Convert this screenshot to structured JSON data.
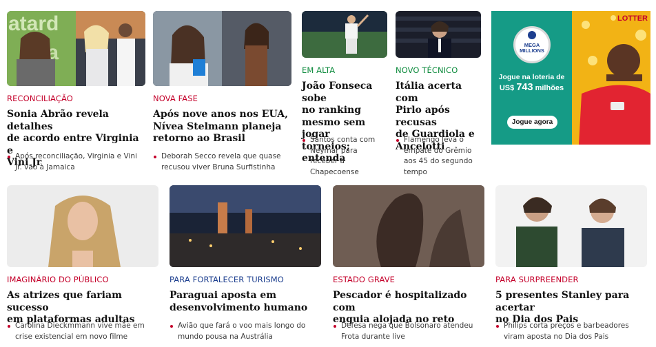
{
  "colors": {
    "kicker_red": "#c4002a",
    "kicker_green": "#0c8a3c",
    "kicker_blue": "#1d3f8f",
    "bullet": "#c4002a"
  },
  "row1": [
    {
      "kicker": "RECONCILIAÇÃO",
      "headline": [
        "Sonia Abrão revela detalhes",
        "de acordo entre Virginia e",
        "Vini Jr"
      ],
      "related": [
        "Após reconciliação, Virginia e Vini",
        "Jr. vão à Jamaica"
      ]
    },
    {
      "kicker": "NOVA FASE",
      "headline": [
        "Após nove anos nos EUA,",
        "Nívea Stelmann planeja",
        "retorno ao Brasil"
      ],
      "related": [
        "Deborah Secco revela que quase",
        "recusou viver Bruna Surfistinha"
      ]
    },
    {
      "kicker": "EM ALTA",
      "headline": [
        "João Fonseca sobe",
        "no ranking",
        "mesmo sem jogar",
        "torneios; entenda"
      ],
      "related": [
        "Santos conta com",
        "Neymar para",
        "receber a",
        "Chapecoense"
      ]
    },
    {
      "kicker": "NOVO TÉCNICO",
      "headline": [
        "Itália acerta com",
        "Pirlo após recusas",
        "de Guardiola e",
        "Ancelotti"
      ],
      "related": [
        "Flamengo leva o",
        "empate do Grêmio",
        "aos 45 do segundo",
        "tempo"
      ]
    }
  ],
  "ad": {
    "brand": "LOTTER",
    "logo": [
      "MEGA",
      "MILLIONS"
    ],
    "line1": "Jogue na loteria de",
    "currency": "US$",
    "amount": "743",
    "unit": "milhões",
    "button": "Jogue agora"
  },
  "row2": [
    {
      "kicker": "IMAGINÁRIO DO PÚBLICO",
      "headline": [
        "As atrizes que fariam sucesso",
        "em plataformas adultas"
      ],
      "related": [
        "Carolina Dieckmmann vive mãe em",
        "crise existencial em novo filme"
      ]
    },
    {
      "kicker": "PARA FORTALECER TURISMO",
      "headline": [
        "Paraguai aposta em",
        "desenvolvimento humano"
      ],
      "related": [
        "Avião que fará o voo mais longo do",
        "mundo pousa na Austrália"
      ]
    },
    {
      "kicker": "ESTADO GRAVE",
      "headline": [
        "Pescador é hospitalizado com",
        "enguia alojada no reto"
      ],
      "related": [
        "Defesa nega que Bolsonaro atendeu",
        "Frota durante live"
      ]
    },
    {
      "kicker": "PARA SURPREENDER",
      "headline": [
        "5 presentes Stanley para acertar",
        "no Dia dos Pais"
      ],
      "related": [
        "Philips corta preços e barbeadores",
        "viram aposta no Dia dos Pais"
      ]
    }
  ]
}
